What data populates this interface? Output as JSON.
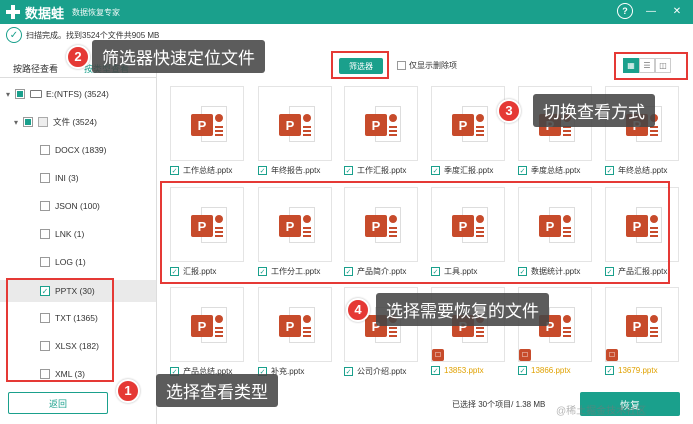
{
  "titlebar": {
    "app_name": "数据蛙",
    "subtitle": "数据恢复专家",
    "help_icon": "?",
    "min_icon": "—",
    "close_icon": "✕"
  },
  "status": {
    "text": "扫描完成。找到3524个文件共905 MB"
  },
  "left": {
    "tabs": [
      "按路径查看",
      "按类型查看"
    ],
    "drive": "E:(NTFS) (3524)",
    "folder": "文件 (3524)",
    "types": [
      {
        "label": "DOCX (1839)"
      },
      {
        "label": "INI (3)"
      },
      {
        "label": "JSON (100)"
      },
      {
        "label": "LNK (1)"
      },
      {
        "label": "LOG (1)"
      },
      {
        "label": "PPTX (30)"
      },
      {
        "label": "TXT (1365)"
      },
      {
        "label": "XLSX (182)"
      },
      {
        "label": "XML (3)"
      }
    ],
    "back_label": "返回"
  },
  "toolbar": {
    "filter_label": "筛选器",
    "show_deleted_label": "仅显示删除项"
  },
  "files": [
    {
      "name": "工作总结.pptx",
      "deleted": false
    },
    {
      "name": "年终报告.pptx",
      "deleted": false
    },
    {
      "name": "工作汇报.pptx",
      "deleted": false
    },
    {
      "name": "季度汇报.pptx",
      "deleted": false
    },
    {
      "name": "季度总结.pptx",
      "deleted": false
    },
    {
      "name": "年终总结.pptx",
      "deleted": false
    },
    {
      "name": "汇报.pptx",
      "deleted": false
    },
    {
      "name": "工作分工.pptx",
      "deleted": false
    },
    {
      "name": "产品简介.pptx",
      "deleted": false
    },
    {
      "name": "工具.pptx",
      "deleted": false
    },
    {
      "name": "数据统计.pptx",
      "deleted": false
    },
    {
      "name": "产品汇报.pptx",
      "deleted": false
    },
    {
      "name": "产品总结.pptx",
      "deleted": false
    },
    {
      "name": "补充.pptx",
      "deleted": false
    },
    {
      "name": "公司介绍.pptx",
      "deleted": false
    },
    {
      "name": "13853.pptx",
      "deleted": true
    },
    {
      "name": "13866.pptx",
      "deleted": true
    },
    {
      "name": "13679.pptx",
      "deleted": true
    }
  ],
  "bottom": {
    "selected_text": "已选择 30个项目/ 1.38 MB",
    "recover_label": "恢复",
    "watermark": "@稀土掘金技术社区"
  },
  "annotations": {
    "c1": {
      "num": "1",
      "text": "选择查看类型"
    },
    "c2": {
      "num": "2",
      "text": "筛选器快速定位文件"
    },
    "c3": {
      "num": "3",
      "text": "切换查看方式"
    },
    "c4": {
      "num": "4",
      "text": "选择需要恢复的文件"
    }
  },
  "colors": {
    "accent": "#1aa08c",
    "annotation": "#e53935",
    "ppt": "#c74b2b",
    "deleted_text": "#e0a100"
  }
}
